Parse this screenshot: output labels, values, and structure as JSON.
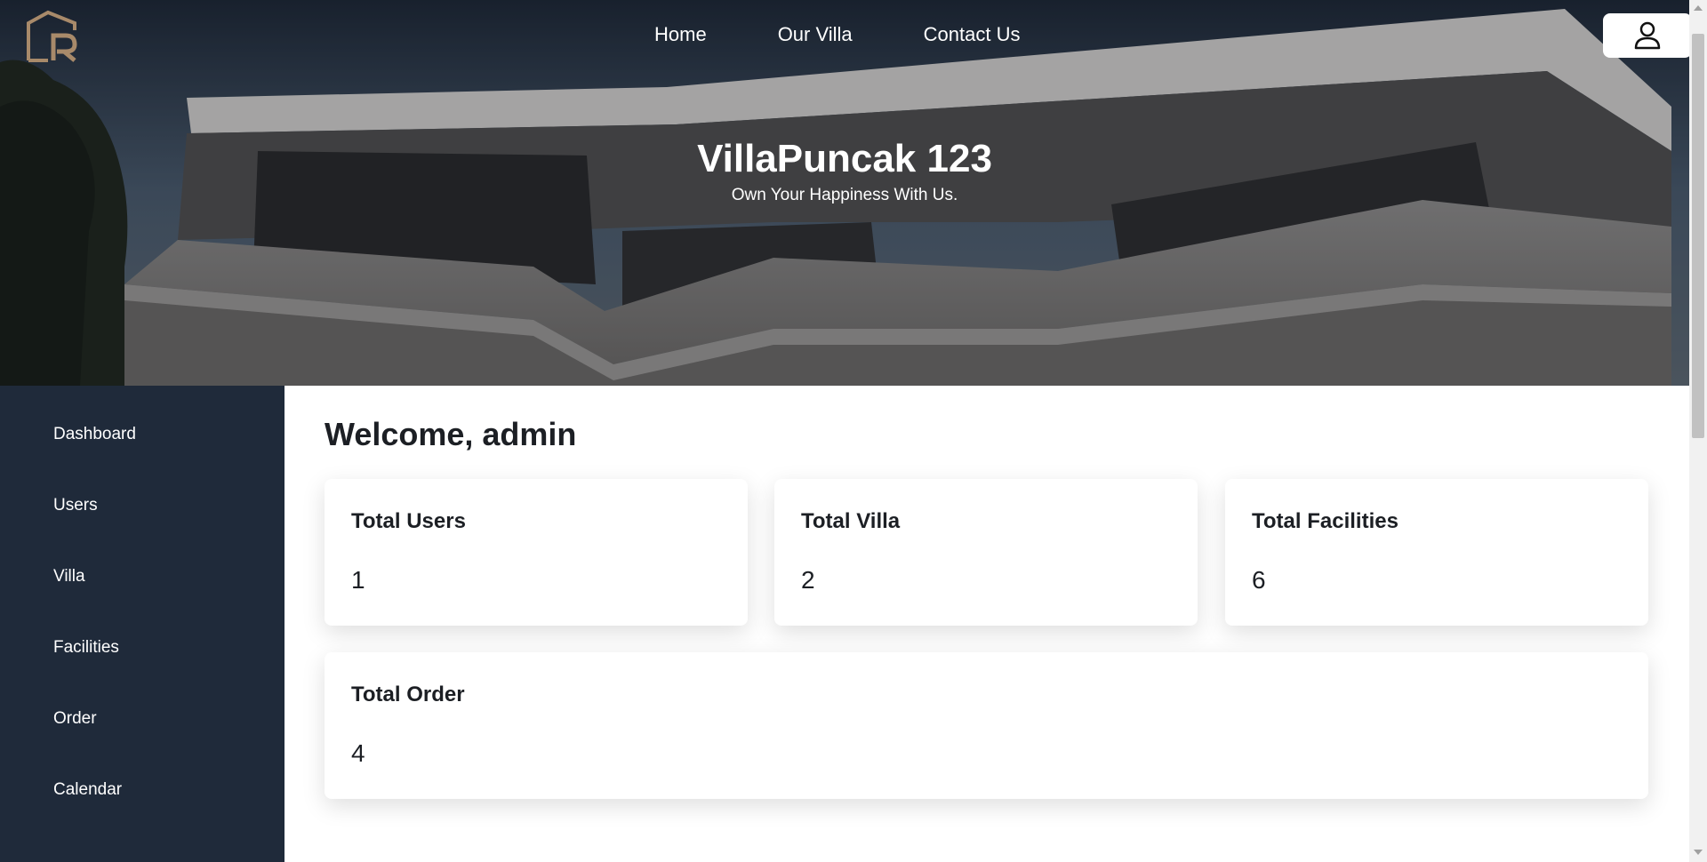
{
  "header": {
    "logo_icon": "lr-logo-icon",
    "nav": [
      {
        "label": "Home"
      },
      {
        "label": "Our Villa"
      },
      {
        "label": "Contact Us"
      }
    ],
    "user_icon": "user-icon"
  },
  "hero": {
    "title": "VillaPuncak 123",
    "subtitle": "Own Your Happiness With Us."
  },
  "sidebar": {
    "items": [
      {
        "label": "Dashboard"
      },
      {
        "label": "Users"
      },
      {
        "label": "Villa"
      },
      {
        "label": "Facilities"
      },
      {
        "label": "Order"
      },
      {
        "label": "Calendar"
      }
    ]
  },
  "main": {
    "welcome": "Welcome, admin",
    "cards": [
      {
        "title": "Total Users",
        "value": "1"
      },
      {
        "title": "Total Villa",
        "value": "2"
      },
      {
        "title": "Total Facilities",
        "value": "6"
      },
      {
        "title": "Total Order",
        "value": "4"
      }
    ]
  },
  "colors": {
    "sidebar_bg": "#1f2a3a",
    "logo_gold": "#a88a6a"
  }
}
